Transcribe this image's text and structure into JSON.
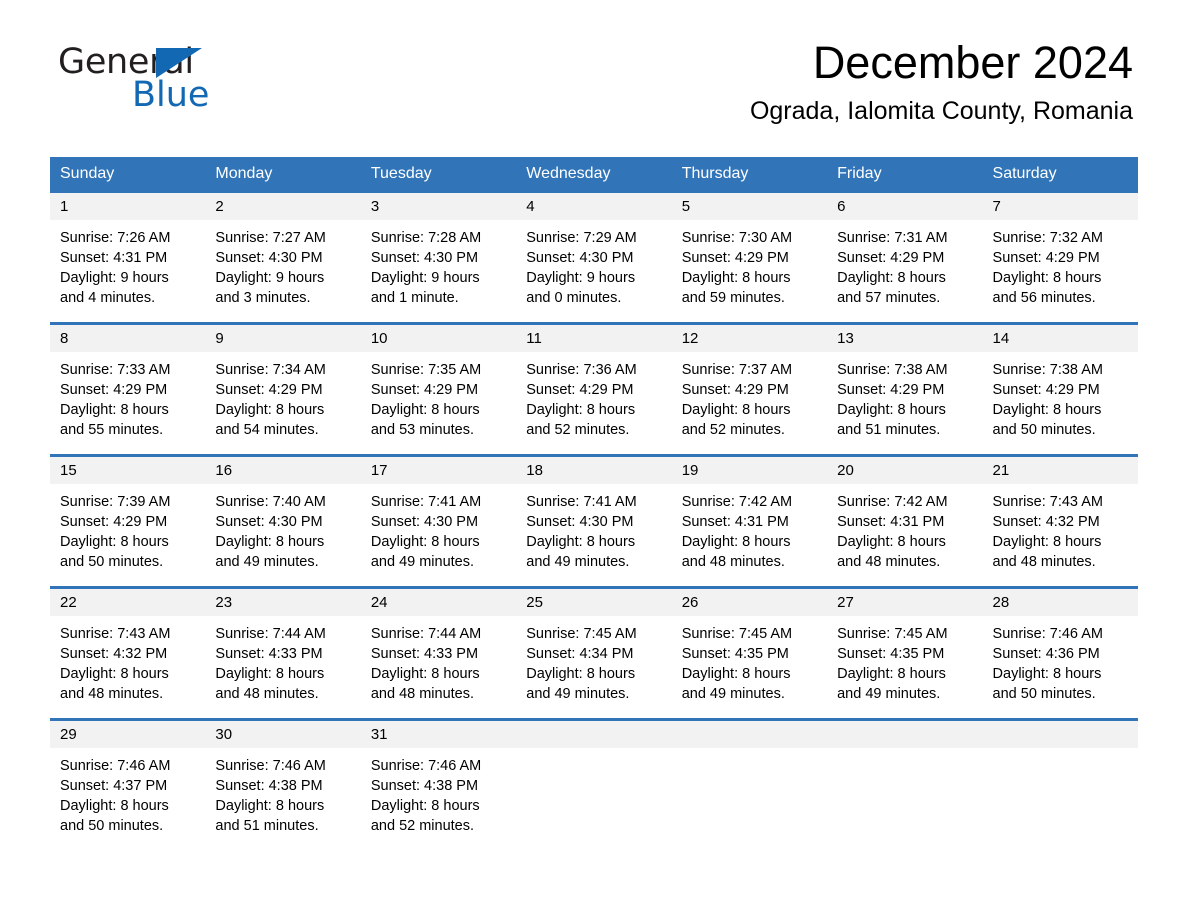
{
  "brand": {
    "name_part1": "General",
    "name_part2": "Blue",
    "triangle_icon": "triangle-logo-icon",
    "accent_color": "#1268b3"
  },
  "header": {
    "title": "December 2024",
    "subtitle": "Ograda, Ialomita County, Romania"
  },
  "theme": {
    "header_blue": "#3175b8",
    "day_band_gray": "#f2f2f2",
    "text_black": "#000000"
  },
  "weekdays": [
    "Sunday",
    "Monday",
    "Tuesday",
    "Wednesday",
    "Thursday",
    "Friday",
    "Saturday"
  ],
  "weeks": [
    [
      {
        "day": "1",
        "sunrise": "Sunrise: 7:26 AM",
        "sunset": "Sunset: 4:31 PM",
        "daylight1": "Daylight: 9 hours",
        "daylight2": "and 4 minutes."
      },
      {
        "day": "2",
        "sunrise": "Sunrise: 7:27 AM",
        "sunset": "Sunset: 4:30 PM",
        "daylight1": "Daylight: 9 hours",
        "daylight2": "and 3 minutes."
      },
      {
        "day": "3",
        "sunrise": "Sunrise: 7:28 AM",
        "sunset": "Sunset: 4:30 PM",
        "daylight1": "Daylight: 9 hours",
        "daylight2": "and 1 minute."
      },
      {
        "day": "4",
        "sunrise": "Sunrise: 7:29 AM",
        "sunset": "Sunset: 4:30 PM",
        "daylight1": "Daylight: 9 hours",
        "daylight2": "and 0 minutes."
      },
      {
        "day": "5",
        "sunrise": "Sunrise: 7:30 AM",
        "sunset": "Sunset: 4:29 PM",
        "daylight1": "Daylight: 8 hours",
        "daylight2": "and 59 minutes."
      },
      {
        "day": "6",
        "sunrise": "Sunrise: 7:31 AM",
        "sunset": "Sunset: 4:29 PM",
        "daylight1": "Daylight: 8 hours",
        "daylight2": "and 57 minutes."
      },
      {
        "day": "7",
        "sunrise": "Sunrise: 7:32 AM",
        "sunset": "Sunset: 4:29 PM",
        "daylight1": "Daylight: 8 hours",
        "daylight2": "and 56 minutes."
      }
    ],
    [
      {
        "day": "8",
        "sunrise": "Sunrise: 7:33 AM",
        "sunset": "Sunset: 4:29 PM",
        "daylight1": "Daylight: 8 hours",
        "daylight2": "and 55 minutes."
      },
      {
        "day": "9",
        "sunrise": "Sunrise: 7:34 AM",
        "sunset": "Sunset: 4:29 PM",
        "daylight1": "Daylight: 8 hours",
        "daylight2": "and 54 minutes."
      },
      {
        "day": "10",
        "sunrise": "Sunrise: 7:35 AM",
        "sunset": "Sunset: 4:29 PM",
        "daylight1": "Daylight: 8 hours",
        "daylight2": "and 53 minutes."
      },
      {
        "day": "11",
        "sunrise": "Sunrise: 7:36 AM",
        "sunset": "Sunset: 4:29 PM",
        "daylight1": "Daylight: 8 hours",
        "daylight2": "and 52 minutes."
      },
      {
        "day": "12",
        "sunrise": "Sunrise: 7:37 AM",
        "sunset": "Sunset: 4:29 PM",
        "daylight1": "Daylight: 8 hours",
        "daylight2": "and 52 minutes."
      },
      {
        "day": "13",
        "sunrise": "Sunrise: 7:38 AM",
        "sunset": "Sunset: 4:29 PM",
        "daylight1": "Daylight: 8 hours",
        "daylight2": "and 51 minutes."
      },
      {
        "day": "14",
        "sunrise": "Sunrise: 7:38 AM",
        "sunset": "Sunset: 4:29 PM",
        "daylight1": "Daylight: 8 hours",
        "daylight2": "and 50 minutes."
      }
    ],
    [
      {
        "day": "15",
        "sunrise": "Sunrise: 7:39 AM",
        "sunset": "Sunset: 4:29 PM",
        "daylight1": "Daylight: 8 hours",
        "daylight2": "and 50 minutes."
      },
      {
        "day": "16",
        "sunrise": "Sunrise: 7:40 AM",
        "sunset": "Sunset: 4:30 PM",
        "daylight1": "Daylight: 8 hours",
        "daylight2": "and 49 minutes."
      },
      {
        "day": "17",
        "sunrise": "Sunrise: 7:41 AM",
        "sunset": "Sunset: 4:30 PM",
        "daylight1": "Daylight: 8 hours",
        "daylight2": "and 49 minutes."
      },
      {
        "day": "18",
        "sunrise": "Sunrise: 7:41 AM",
        "sunset": "Sunset: 4:30 PM",
        "daylight1": "Daylight: 8 hours",
        "daylight2": "and 49 minutes."
      },
      {
        "day": "19",
        "sunrise": "Sunrise: 7:42 AM",
        "sunset": "Sunset: 4:31 PM",
        "daylight1": "Daylight: 8 hours",
        "daylight2": "and 48 minutes."
      },
      {
        "day": "20",
        "sunrise": "Sunrise: 7:42 AM",
        "sunset": "Sunset: 4:31 PM",
        "daylight1": "Daylight: 8 hours",
        "daylight2": "and 48 minutes."
      },
      {
        "day": "21",
        "sunrise": "Sunrise: 7:43 AM",
        "sunset": "Sunset: 4:32 PM",
        "daylight1": "Daylight: 8 hours",
        "daylight2": "and 48 minutes."
      }
    ],
    [
      {
        "day": "22",
        "sunrise": "Sunrise: 7:43 AM",
        "sunset": "Sunset: 4:32 PM",
        "daylight1": "Daylight: 8 hours",
        "daylight2": "and 48 minutes."
      },
      {
        "day": "23",
        "sunrise": "Sunrise: 7:44 AM",
        "sunset": "Sunset: 4:33 PM",
        "daylight1": "Daylight: 8 hours",
        "daylight2": "and 48 minutes."
      },
      {
        "day": "24",
        "sunrise": "Sunrise: 7:44 AM",
        "sunset": "Sunset: 4:33 PM",
        "daylight1": "Daylight: 8 hours",
        "daylight2": "and 48 minutes."
      },
      {
        "day": "25",
        "sunrise": "Sunrise: 7:45 AM",
        "sunset": "Sunset: 4:34 PM",
        "daylight1": "Daylight: 8 hours",
        "daylight2": "and 49 minutes."
      },
      {
        "day": "26",
        "sunrise": "Sunrise: 7:45 AM",
        "sunset": "Sunset: 4:35 PM",
        "daylight1": "Daylight: 8 hours",
        "daylight2": "and 49 minutes."
      },
      {
        "day": "27",
        "sunrise": "Sunrise: 7:45 AM",
        "sunset": "Sunset: 4:35 PM",
        "daylight1": "Daylight: 8 hours",
        "daylight2": "and 49 minutes."
      },
      {
        "day": "28",
        "sunrise": "Sunrise: 7:46 AM",
        "sunset": "Sunset: 4:36 PM",
        "daylight1": "Daylight: 8 hours",
        "daylight2": "and 50 minutes."
      }
    ],
    [
      {
        "day": "29",
        "sunrise": "Sunrise: 7:46 AM",
        "sunset": "Sunset: 4:37 PM",
        "daylight1": "Daylight: 8 hours",
        "daylight2": "and 50 minutes."
      },
      {
        "day": "30",
        "sunrise": "Sunrise: 7:46 AM",
        "sunset": "Sunset: 4:38 PM",
        "daylight1": "Daylight: 8 hours",
        "daylight2": "and 51 minutes."
      },
      {
        "day": "31",
        "sunrise": "Sunrise: 7:46 AM",
        "sunset": "Sunset: 4:38 PM",
        "daylight1": "Daylight: 8 hours",
        "daylight2": "and 52 minutes."
      },
      {
        "day": "",
        "sunrise": "",
        "sunset": "",
        "daylight1": "",
        "daylight2": ""
      },
      {
        "day": "",
        "sunrise": "",
        "sunset": "",
        "daylight1": "",
        "daylight2": ""
      },
      {
        "day": "",
        "sunrise": "",
        "sunset": "",
        "daylight1": "",
        "daylight2": ""
      },
      {
        "day": "",
        "sunrise": "",
        "sunset": "",
        "daylight1": "",
        "daylight2": ""
      }
    ]
  ]
}
